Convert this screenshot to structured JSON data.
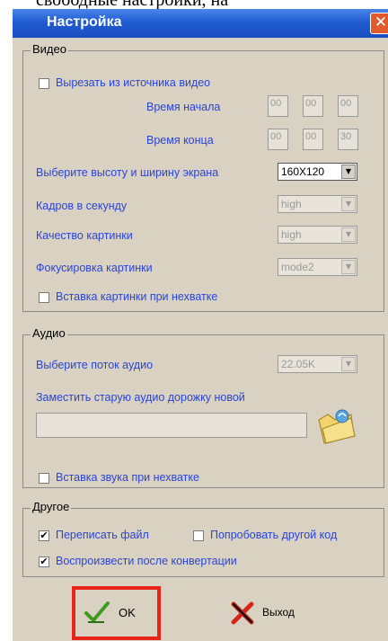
{
  "page_caption_fragment": "свободные настройки, на",
  "window": {
    "title": "Настройка",
    "close_glyph": "✕"
  },
  "video": {
    "legend": "Видео",
    "cut_source_label": "Вырезать из источника видео",
    "start_time_label": "Время начала",
    "start_time": [
      "00",
      "00",
      "00"
    ],
    "end_time_label": "Время конца",
    "end_time": [
      "00",
      "00",
      "30"
    ],
    "screen_size_label": "Выберите высоту и ширину экрана",
    "screen_size_value": "160X120",
    "fps_label": "Кадров в секунду",
    "fps_value": "high",
    "quality_label": "Качество картинки",
    "quality_value": "high",
    "focus_label": "Фокусировка картинки",
    "focus_value": "mode2",
    "insert_image_label": "Вставка картинки при нехватке"
  },
  "audio": {
    "legend": "Аудио",
    "stream_label": "Выберите поток аудио",
    "stream_value": "22.05K",
    "replace_label": "Заместить старую аудио дорожку новой",
    "file_path": "",
    "insert_sound_label": "Вставка звука при нехватке"
  },
  "other": {
    "legend": "Другое",
    "overwrite_label": "Переписать файл",
    "overwrite_checked": true,
    "try_other_codec_label": "Попробовать другой код",
    "try_other_codec_checked": false,
    "play_after_label": "Воспроизвести после конвертации",
    "play_after_checked": true
  },
  "buttons": {
    "ok_label": "OK",
    "exit_label": "Выход"
  },
  "glyphs": {
    "checked": "✔",
    "dropdown": "▼"
  },
  "colors": {
    "label_blue": "#2a44d8",
    "titlebar_blue": "#1f5bd1",
    "highlight_red": "#e8231a",
    "window_bg": "#d9d2c3"
  },
  "icons": [
    "close-icon",
    "folder-icon",
    "checkmark-icon",
    "x-icon",
    "dropdown-arrow-icon"
  ]
}
